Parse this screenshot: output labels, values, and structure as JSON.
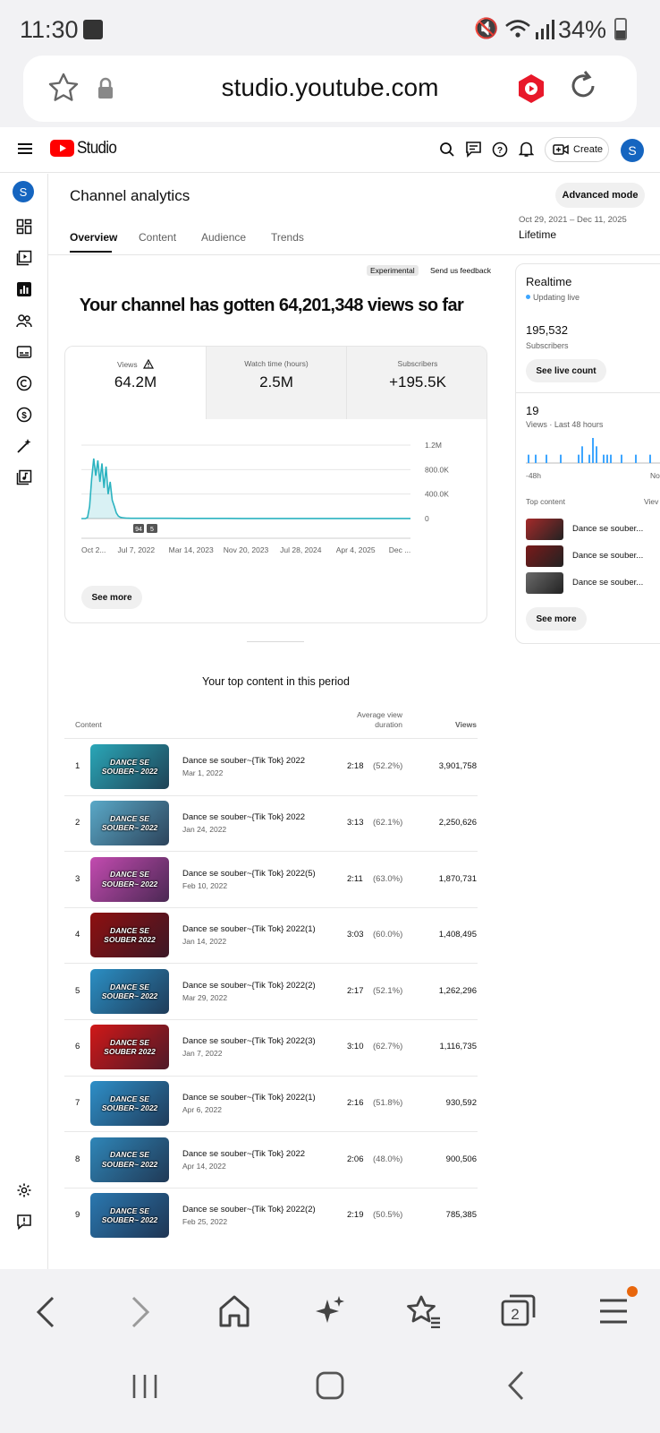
{
  "status_bar": {
    "time": "11:30",
    "battery": "34%"
  },
  "browser": {
    "url": "studio.youtube.com"
  },
  "header": {
    "logo_text": "Studio",
    "create_label": "Create",
    "avatar_letter": "S"
  },
  "sidebar": {
    "avatar_letter": "S"
  },
  "page": {
    "title": "Channel analytics",
    "advanced_mode": "Advanced mode",
    "date_range": "Oct 29, 2021 – Dec 11, 2025",
    "date_range_label": "Lifetime",
    "tabs": [
      "Overview",
      "Content",
      "Audience",
      "Trends"
    ],
    "experimental_badge": "Experimental",
    "send_feedback": "Send us feedback",
    "headline": "Your channel has gotten 64,201,348 views so far"
  },
  "metrics": [
    {
      "label": "Views",
      "value": "64.2M"
    },
    {
      "label": "Watch time (hours)",
      "value": "2.5M"
    },
    {
      "label": "Subscribers",
      "value": "+195.5K"
    }
  ],
  "chart_data": {
    "type": "line",
    "ylim": [
      0,
      1200000
    ],
    "y_ticks": [
      "1.2M",
      "800.0K",
      "400.0K",
      "0"
    ],
    "x_ticks": [
      "Oct 2...",
      "Jul 7, 2022",
      "Mar 14, 2023",
      "Nov 20, 2023",
      "Jul 28, 2024",
      "Apr 4, 2025",
      "Dec ..."
    ],
    "markers": [
      "94",
      "5"
    ],
    "series": [
      {
        "values": [
          0,
          0,
          0,
          20000,
          200000,
          650000,
          980000,
          700000,
          950000,
          600000,
          900000,
          500000,
          850000,
          400000,
          600000,
          300000,
          200000,
          90000,
          40000,
          20000,
          15000,
          10000,
          8000,
          6000,
          5000,
          4000,
          4000,
          3000,
          3000,
          3000,
          2000,
          2000,
          2000,
          2000,
          2000,
          2000,
          2000,
          2000,
          2000,
          2000
        ]
      }
    ]
  },
  "chart_see_more": "See more",
  "top_content": {
    "title": "Your top content in this period",
    "headers": {
      "content": "Content",
      "avd": "Average view duration",
      "views": "Views"
    },
    "rows": [
      {
        "rank": "1",
        "thumb": "DANCE SE SOUBER~ 2022",
        "title": "Dance se souber~{Tik Tok} 2022",
        "date": "Mar 1, 2022",
        "avd": "2:18",
        "pct": "(52.2%)",
        "views": "3,901,758",
        "color": "#2aa7b8"
      },
      {
        "rank": "2",
        "thumb": "DANCE SE SOUBER~ 2022",
        "title": "Dance se souber~{Tik Tok} 2022",
        "date": "Jan 24, 2022",
        "avd": "3:13",
        "pct": "(62.1%)",
        "views": "2,250,626",
        "color": "#5aa9c8"
      },
      {
        "rank": "3",
        "thumb": "DANCE SE SOUBER~ 2022",
        "title": "Dance se souber~{Tik Tok} 2022(5)",
        "date": "Feb 10, 2022",
        "avd": "2:11",
        "pct": "(63.0%)",
        "views": "1,870,731",
        "color": "#c34bb0"
      },
      {
        "rank": "4",
        "thumb": "DANCE SE SOUBER 2022",
        "title": "Dance se souber~{Tik Tok} 2022(1)",
        "date": "Jan 14, 2022",
        "avd": "3:03",
        "pct": "(60.0%)",
        "views": "1,408,495",
        "color": "#8e1010"
      },
      {
        "rank": "5",
        "thumb": "DANCE SE SOUBER~ 2022",
        "title": "Dance se souber~{Tik Tok} 2022(2)",
        "date": "Mar 29, 2022",
        "avd": "2:17",
        "pct": "(52.1%)",
        "views": "1,262,296",
        "color": "#2b8fc4"
      },
      {
        "rank": "6",
        "thumb": "DANCE SE SOUBER 2022",
        "title": "Dance se souber~{Tik Tok} 2022(3)",
        "date": "Jan 7, 2022",
        "avd": "3:10",
        "pct": "(62.7%)",
        "views": "1,116,735",
        "color": "#d01818"
      },
      {
        "rank": "7",
        "thumb": "DANCE SE SOUBER~ 2022",
        "title": "Dance se souber~{Tik Tok} 2022(1)",
        "date": "Apr 6, 2022",
        "avd": "2:16",
        "pct": "(51.8%)",
        "views": "930,592",
        "color": "#2e8fc8"
      },
      {
        "rank": "8",
        "thumb": "DANCE SE SOUBER~ 2022",
        "title": "Dance se souber~{Tik Tok} 2022",
        "date": "Apr 14, 2022",
        "avd": "2:06",
        "pct": "(48.0%)",
        "views": "900,506",
        "color": "#2f86b8"
      },
      {
        "rank": "9",
        "thumb": "DANCE SE SOUBER~ 2022",
        "title": "Dance se souber~{Tik Tok} 2022(2)",
        "date": "Feb 25, 2022",
        "avd": "2:19",
        "pct": "(50.5%)",
        "views": "785,385",
        "color": "#2a78b0"
      }
    ]
  },
  "realtime": {
    "title": "Realtime",
    "status": "Updating live",
    "subscribers_value": "195,532",
    "subscribers_label": "Subscribers",
    "live_count_button": "See live count",
    "views_value": "19",
    "views_label": "Views · Last 48 hours",
    "axis_left": "-48h",
    "axis_right": "No",
    "bars": [
      1,
      0,
      1,
      0,
      0,
      1,
      0,
      0,
      0,
      1,
      0,
      0,
      0,
      0,
      1,
      2,
      0,
      1,
      3,
      2,
      0,
      1,
      1,
      1,
      0,
      0,
      1,
      0,
      0,
      0,
      1,
      0,
      0,
      0,
      1,
      0,
      0,
      0,
      0,
      1
    ],
    "top_content_label": "Top content",
    "top_content_col": "Viev",
    "items": [
      {
        "title": "Dance se souber...",
        "color": "#a52a2a"
      },
      {
        "title": "Dance se souber...",
        "color": "#7a1a1a"
      },
      {
        "title": "Dance se souber...",
        "color": "#6a6a6a"
      }
    ],
    "see_more": "See more"
  },
  "accent": {
    "youtube_red": "#ff0000",
    "chart_line": "#2bb3c0",
    "live_dot": "#3ea6ff"
  }
}
